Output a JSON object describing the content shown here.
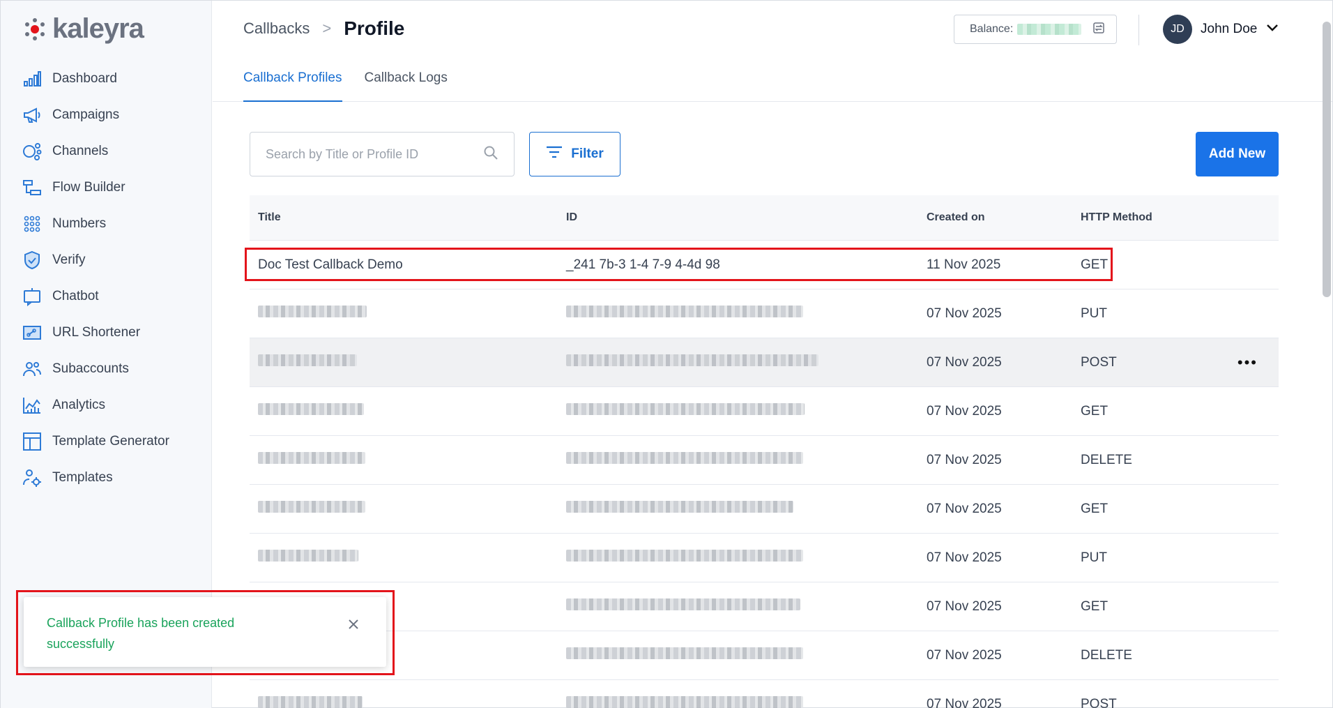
{
  "app": {
    "brand": "kaleyra"
  },
  "sidebar": {
    "items": [
      {
        "label": "Dashboard",
        "icon": "bar-chart-icon"
      },
      {
        "label": "Campaigns",
        "icon": "megaphone-icon"
      },
      {
        "label": "Channels",
        "icon": "channels-icon"
      },
      {
        "label": "Flow Builder",
        "icon": "flow-icon"
      },
      {
        "label": "Numbers",
        "icon": "grid-dots-icon"
      },
      {
        "label": "Verify",
        "icon": "shield-check-icon"
      },
      {
        "label": "Chatbot",
        "icon": "chatbot-icon"
      },
      {
        "label": "URL Shortener",
        "icon": "link-icon"
      },
      {
        "label": "Subaccounts",
        "icon": "users-icon"
      },
      {
        "label": "Analytics",
        "icon": "analytics-icon"
      },
      {
        "label": "Template Generator",
        "icon": "layout-icon"
      },
      {
        "label": "Templates",
        "icon": "templates-gear-icon"
      }
    ]
  },
  "header": {
    "breadcrumb_parent": "Callbacks",
    "breadcrumb_separator": ">",
    "title": "Profile",
    "balance_label": "Balance:",
    "user_initials": "JD",
    "user_name": "John Doe"
  },
  "tabs": [
    {
      "label": "Callback Profiles",
      "active": true
    },
    {
      "label": "Callback Logs",
      "active": false
    }
  ],
  "toolbar": {
    "search_placeholder": "Search by Title or Profile ID",
    "filter_label": "Filter",
    "add_label": "Add New"
  },
  "table": {
    "columns": [
      "Title",
      "ID",
      "Created on",
      "HTTP Method"
    ],
    "rows": [
      {
        "title": "Doc Test Callback Demo",
        "id": "_241 7b-3 1-4 7-9 4-4d 98",
        "created": "11 Nov 2025",
        "method": "GET"
      },
      {
        "title": "",
        "id": "",
        "created": "07 Nov 2025",
        "method": "PUT"
      },
      {
        "title": "",
        "id": "",
        "created": "07 Nov 2025",
        "method": "POST"
      },
      {
        "title": "",
        "id": "",
        "created": "07 Nov 2025",
        "method": "GET"
      },
      {
        "title": "",
        "id": "",
        "created": "07 Nov 2025",
        "method": "DELETE"
      },
      {
        "title": "",
        "id": "",
        "created": "07 Nov 2025",
        "method": "GET"
      },
      {
        "title": "",
        "id": "",
        "created": "07 Nov 2025",
        "method": "PUT"
      },
      {
        "title": "",
        "id": "",
        "created": "07 Nov 2025",
        "method": "GET"
      },
      {
        "title": "",
        "id": "",
        "created": "07 Nov 2025",
        "method": "DELETE"
      },
      {
        "title": "",
        "id": "",
        "created": "07 Nov 2025",
        "method": "POST"
      }
    ],
    "row_more": "•••"
  },
  "toast": {
    "message": "Callback Profile has been created successfully"
  },
  "colors": {
    "accent": "#1a73e8",
    "highlight": "#e3141b",
    "success": "#1aa35b"
  }
}
